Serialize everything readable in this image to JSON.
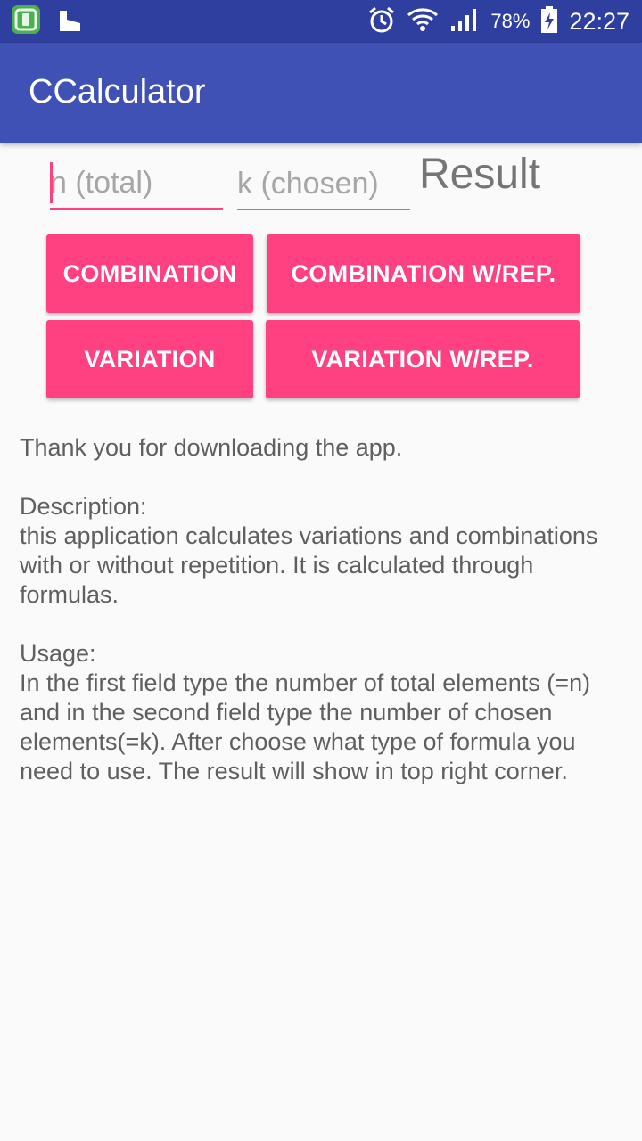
{
  "status_bar": {
    "battery_percent": "78%",
    "time": "22:27",
    "icons": [
      "app-notification-icon",
      "piano-icon",
      "alarm-icon",
      "wifi-icon",
      "signal-icon",
      "battery-charging-icon"
    ]
  },
  "app_bar": {
    "title": "CCalculator"
  },
  "inputs": {
    "n_placeholder": "n (total)",
    "k_placeholder": "k (chosen)"
  },
  "result_label": "Result",
  "buttons": {
    "combination": "COMBINATION",
    "combination_rep": "COMBINATION W/REP.",
    "variation": "VARIATION",
    "variation_rep": "VARIATION W/REP."
  },
  "description": "Thank you for downloading the app.\n\n Description:\nthis application calculates variations and combinations with or without repetition. It is calculated through formulas.\n\n Usage:\nIn the first field type the number of total elements (=n) and in the second field type the number of chosen elements(=k). After choose what type of formula you need to use. The result will show in top right corner.",
  "colors": {
    "status_bar": "#2f3f9f",
    "app_bar": "#3f51b5",
    "accent": "#ff4081",
    "background": "#fafafa"
  }
}
